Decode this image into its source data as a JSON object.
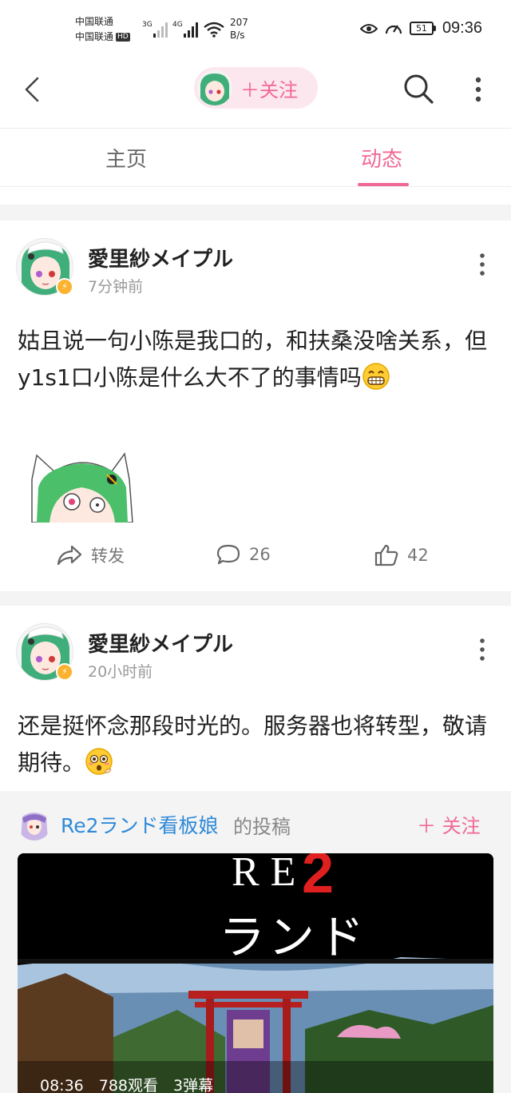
{
  "status_bar": {
    "carrier1": "中国联通",
    "carrier2": "中国联通",
    "hd": "HD",
    "sig1_label": "3G",
    "sig2_label": "4G",
    "net_speed_value": "207",
    "net_speed_unit": "B/s",
    "battery": "51",
    "time": "09:36"
  },
  "nav": {
    "follow_label": "＋关注",
    "icons": [
      "back-icon",
      "search-icon",
      "more-vertical-icon"
    ]
  },
  "tabs": [
    {
      "label": "主页",
      "active": false
    },
    {
      "label": "动态",
      "active": true
    }
  ],
  "colors": {
    "accent": "#f06994",
    "link": "#2e8ad8",
    "badge": "#fbb22e"
  },
  "posts": [
    {
      "author": "愛里紗メイプル",
      "time": "7分钟前",
      "text": "姑且说一句小陈是我口的，和扶桑没啥关系，但y1s1口小陈是什么大不了的事情吗",
      "emoji": "grin-emoji",
      "forward_label": "转发",
      "comments": "26",
      "likes": "42"
    },
    {
      "author": "愛里紗メイプル",
      "time": "20小时前",
      "text": "还是挺怀念那段时光的。服务器也将转型，敬请期待。",
      "emoji": "flushed-emoji",
      "repost": {
        "author": "Re2ランド看板娘",
        "suffix": "的投稿",
        "follow_label": "＋ 关注",
        "video_title_re": "RE",
        "video_title_num": "2",
        "video_title_kana": "ランド",
        "meta": "08:36　788观看　3弹幕"
      }
    }
  ]
}
